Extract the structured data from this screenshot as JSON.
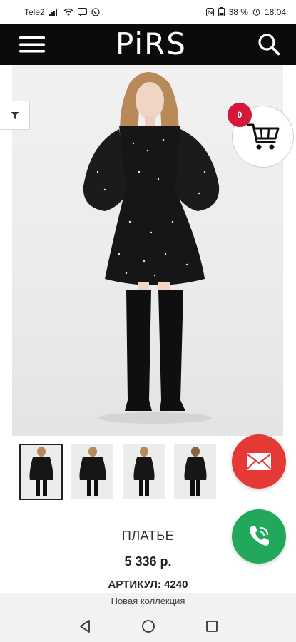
{
  "status_bar": {
    "carrier": "Tele2",
    "battery": "38 %",
    "time": "18:04"
  },
  "header": {
    "logo": "PiRS",
    "menu_icon": "hamburger-menu-icon",
    "search_icon": "search-icon"
  },
  "cart": {
    "count": "0",
    "icon": "shopping-cart-icon"
  },
  "filter": {
    "icon": "filter-funnel-icon"
  },
  "contact": {
    "mail_icon": "mail-envelope-icon",
    "phone_icon": "phone-call-icon"
  },
  "product": {
    "name": "ПЛАТЬЕ",
    "price": "5 336 р.",
    "sku": "АРТИКУЛ: 4240",
    "collection": "Новая коллекция",
    "thumbnail_count": 4
  },
  "colors": {
    "header_bg": "#0b0b0b",
    "cart_badge": "#d5173b",
    "mail_fab": "#e53935",
    "phone_fab": "#22a85a"
  }
}
